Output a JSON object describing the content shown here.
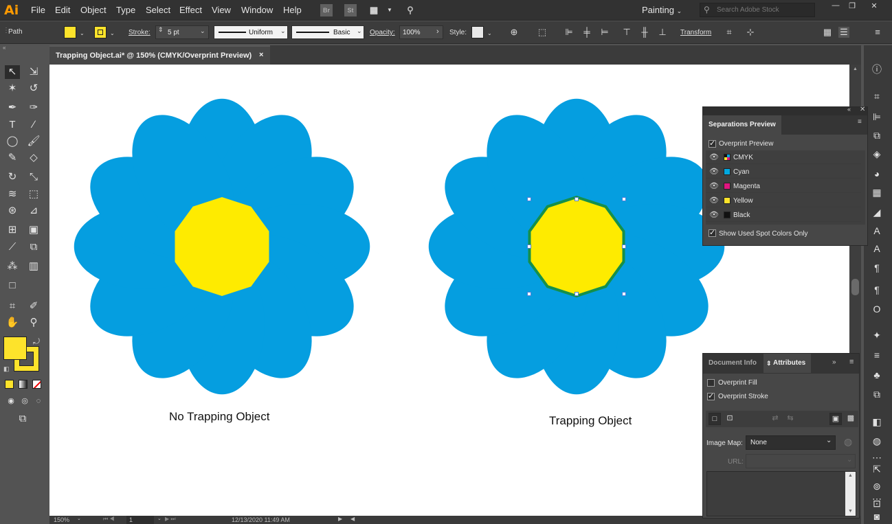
{
  "app": {
    "logo": "Ai"
  },
  "menu": [
    "File",
    "Edit",
    "Object",
    "Type",
    "Select",
    "Effect",
    "View",
    "Window",
    "Help"
  ],
  "app_icons": [
    "Br",
    "St"
  ],
  "workspace": "Painting",
  "search_placeholder": "Search Adobe Stock",
  "control": {
    "selection_label": "Path",
    "fill_color": "#fde32b",
    "stroke_label": "Stroke:",
    "stroke_weight": "5 pt",
    "profile_uniform": "Uniform",
    "profile_basic": "Basic",
    "opacity_label": "Opacity:",
    "opacity_value": "100%",
    "style_label": "Style:",
    "transform_label": "Transform"
  },
  "document_tab": {
    "title": "Trapping Object.ai* @ 150% (CMYK/Overprint Preview)",
    "close": "×"
  },
  "artwork": {
    "petal_color": "#059ee0",
    "center_color": "#feeb00",
    "trap_stroke_color": "#15904a",
    "caption_left": "No Trapping Object",
    "caption_right": "Trapping Object"
  },
  "separations_panel": {
    "title": "Separations Preview",
    "overprint_preview": "Overprint Preview",
    "overprint_preview_checked": true,
    "plates": [
      {
        "name": "CMYK",
        "color": "cmyk"
      },
      {
        "name": "Cyan",
        "color": "#00a8e0"
      },
      {
        "name": "Magenta",
        "color": "#e0157f"
      },
      {
        "name": "Yellow",
        "color": "#fde32b"
      },
      {
        "name": "Black",
        "color": "#111111"
      }
    ],
    "show_spot": "Show Used Spot Colors Only",
    "show_spot_checked": true
  },
  "attributes_panel": {
    "tab_docinfo": "Document Info",
    "tab_attributes": "Attributes",
    "overprint_fill": "Overprint Fill",
    "overprint_fill_checked": false,
    "overprint_stroke": "Overprint Stroke",
    "overprint_stroke_checked": true,
    "image_map_label": "Image Map:",
    "image_map_value": "None",
    "url_label": "URL:"
  },
  "status": {
    "zoom": "150%",
    "artboard": "1",
    "datetime": "12/13/2020  11:49 AM"
  }
}
